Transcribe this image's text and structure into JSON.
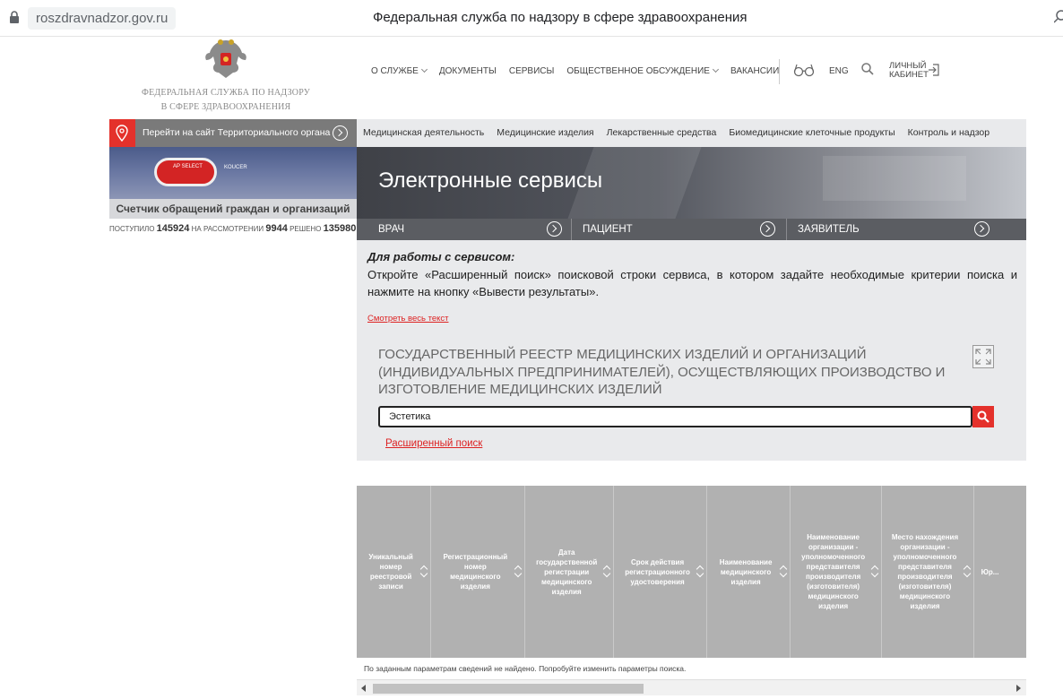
{
  "browser": {
    "url": "roszdravnadzor.gov.ru",
    "title": "Федеральная служба по надзору в сфере здравоохранения"
  },
  "logo": {
    "line1": "ФЕДЕРАЛЬНАЯ СЛУЖБА ПО НАДЗОРУ",
    "line2": "В СФЕРЕ ЗДРАВООХРАНЕНИЯ"
  },
  "top_menu": {
    "items": [
      "О службе",
      "Документы",
      "Сервисы",
      "Общественное обсуждение",
      "Вакансии"
    ],
    "lang": "ENG",
    "cabinet_line1": "Личный",
    "cabinet_line2": "кабинет"
  },
  "territorial": {
    "label": "Перейти на сайт Территориального органа"
  },
  "subnav": {
    "items": [
      "Медицинская деятельность",
      "Медицинские изделия",
      "Лекарственные средства",
      "Биомедицинские клеточные продукты",
      "Контроль и надзор"
    ]
  },
  "counter": {
    "badge": "AP SELECT",
    "badge_side": "KOUCER",
    "title": "Счетчик обращений граждан и организаций",
    "received_label": "ПОСТУПИЛО",
    "received_value": "145924",
    "review_label": "НА РАССМОТРЕНИИ",
    "review_value": "9944",
    "resolved_label": "РЕШЕНО",
    "resolved_value": "135980"
  },
  "hero": {
    "title": "Электронные сервисы",
    "roles": [
      "ВРАЧ",
      "ПАЦИЕНТ",
      "ЗАЯВИТЕЛЬ"
    ]
  },
  "content": {
    "work_title": "Для работы с сервисом",
    "work_text": "Откройте «Расширенный поиск» поисковой строки сервиса, в котором задайте необходимые критерии поиска и нажмите на кнопку «Вывести результаты».",
    "see_all": "Смотреть весь текст",
    "registry_title": "ГОСУДАРСТВЕННЫЙ РЕЕСТР МЕДИЦИНСКИХ ИЗДЕЛИЙ И ОРГАНИЗАЦИЙ (ИНДИВИДУАЛЬНЫХ ПРЕДПРИНИМАТЕЛЕЙ), ОСУЩЕСТВЛЯЮЩИХ ПРОИЗВОДСТВО И ИЗГОТОВЛЕНИЕ МЕДИЦИНСКИХ ИЗДЕЛИЙ",
    "search_value": "Эстетика",
    "advanced_search": "Расширенный поиск"
  },
  "table": {
    "columns": [
      "Уникальный номер реестровой записи",
      "Регистрационный номер медицинского изделия",
      "Дата государственной регистрации медицинского изделия",
      "Срок действия регистрационного удостоверения",
      "Наименование медицинского изделия",
      "Наименование организации - уполномоченного представителя производителя (изготовителя) медицинского изделия",
      "Место нахождения организации - уполномоченного представителя производителя (изготовителя) медицинского изделия",
      "Юр..."
    ],
    "empty_message": "По заданным параметрам сведений не найдено. Попробуйте изменить параметры поиска."
  },
  "colors": {
    "accent_red": "#e4312b",
    "panel_gray": "#e9eaec",
    "header_gray": "#b1b1b1"
  },
  "icons": [
    "lock-icon",
    "search-icon",
    "emblem-icon",
    "glasses-icon",
    "login-icon",
    "map-pin-icon",
    "arrow-circle-icon",
    "expand-icon",
    "sort-icon"
  ]
}
